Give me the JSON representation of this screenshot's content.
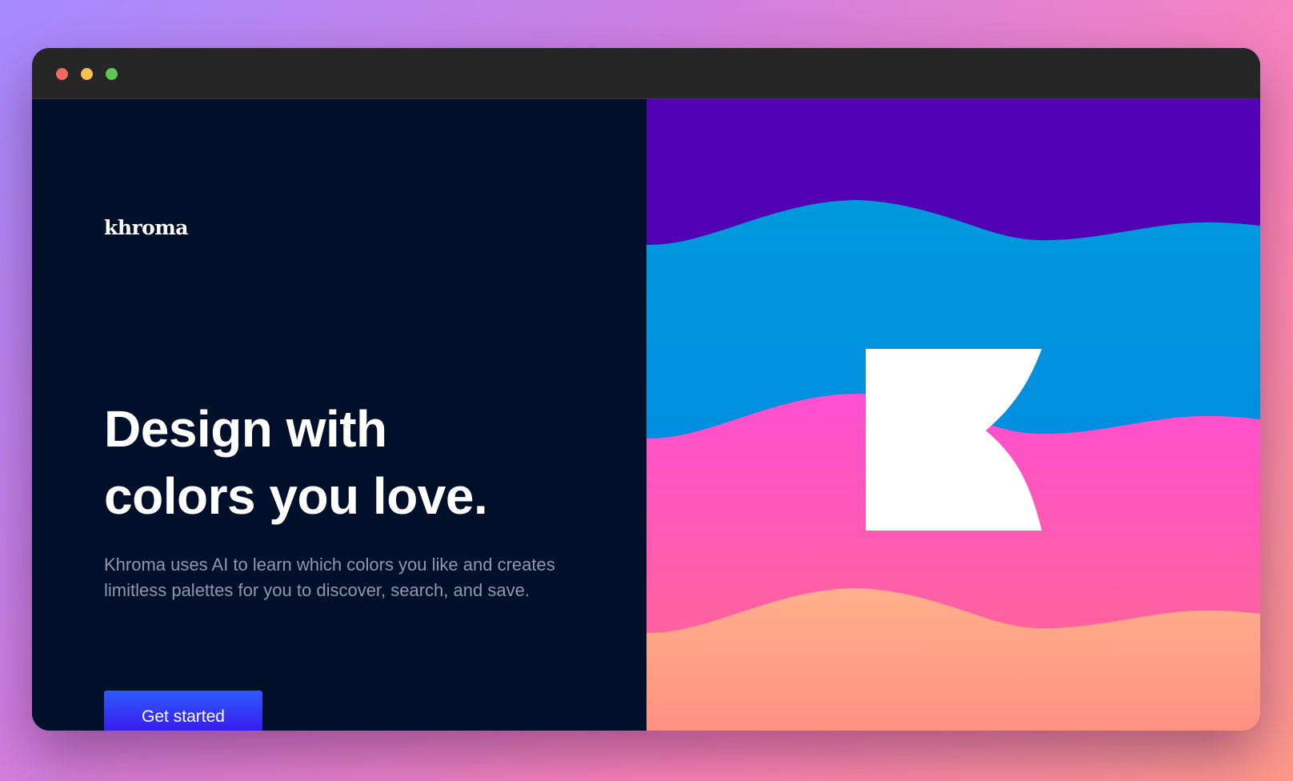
{
  "app": {
    "logo_text": "khroma"
  },
  "hero": {
    "headline_line1": "Design with",
    "headline_line2": "colors you love.",
    "description": "Khroma uses AI to learn which colors you like and creates limitless palettes for you to discover, search, and save.",
    "cta_label": "Get started"
  },
  "window_controls": {
    "close_color": "#ed6a5e",
    "minimize_color": "#f5bf4f",
    "maximize_color": "#61c554"
  },
  "colors": {
    "page_background": "#000f2a",
    "accent_blue": "#2e5bff",
    "accent_violet": "#3a0ae8",
    "wave_purple": "#5200b3",
    "wave_blue": "#0099dd",
    "wave_pink": "#ff4fd2",
    "wave_peach": "#ffa98c"
  },
  "icons": {
    "brand_mark": "khroma-k-logo-icon"
  }
}
